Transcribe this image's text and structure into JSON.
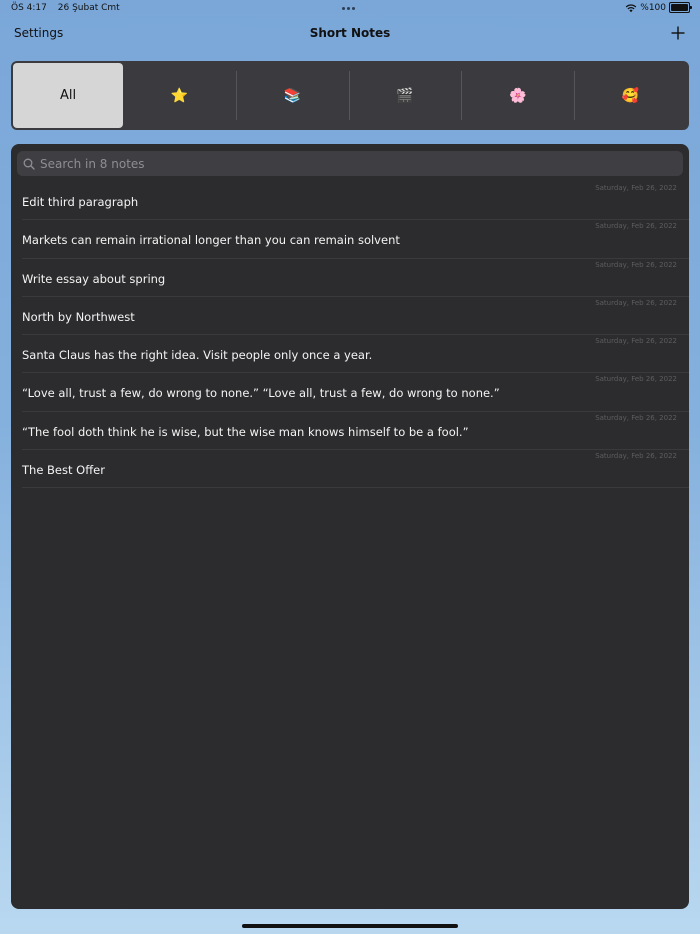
{
  "status_bar": {
    "time": "ÖS 4:17",
    "date": "26 Şubat Cmt",
    "battery": "%100",
    "battery_level": 1.0
  },
  "nav": {
    "settings_label": "Settings",
    "title": "Short Notes",
    "add_icon": "plus-icon"
  },
  "filters": [
    {
      "label": "All",
      "selected": true
    },
    {
      "label": "⭐",
      "icon": "star-icon"
    },
    {
      "label": "📚",
      "icon": "books-icon"
    },
    {
      "label": "🎬",
      "icon": "clapper-board-icon"
    },
    {
      "label": "🌸",
      "icon": "cherry-blossom-icon"
    },
    {
      "label": "🥰",
      "icon": "smiling-face-with-hearts-icon"
    }
  ],
  "search": {
    "placeholder": "Search in 8 notes",
    "value": ""
  },
  "notes": [
    {
      "title": "Edit third paragraph",
      "date": "Saturday, Feb 26, 2022"
    },
    {
      "title": "Markets can remain irrational longer than you can remain solvent",
      "date": "Saturday, Feb 26, 2022"
    },
    {
      "title": "Write essay about spring",
      "date": "Saturday, Feb 26, 2022"
    },
    {
      "title": "North by Northwest",
      "date": "Saturday, Feb 26, 2022"
    },
    {
      "title": "Santa Claus has the right idea. Visit people only once a year.",
      "date": "Saturday, Feb 26, 2022"
    },
    {
      "title": "“Love all, trust a few, do wrong to none.” “Love all, trust a few, do wrong to none.”",
      "date": "Saturday, Feb 26, 2022"
    },
    {
      "title": "“The fool doth think he is wise, but the wise man knows himself to be a fool.”",
      "date": "Saturday, Feb 26, 2022"
    },
    {
      "title": "The Best Offer",
      "date": "Saturday, Feb 26, 2022"
    }
  ],
  "colors": {
    "background_top": "#7aa7d8",
    "panel": "#2c2c2e",
    "segment_bar": "#3b3b3f",
    "segment_selected": "#d6d6d6"
  }
}
